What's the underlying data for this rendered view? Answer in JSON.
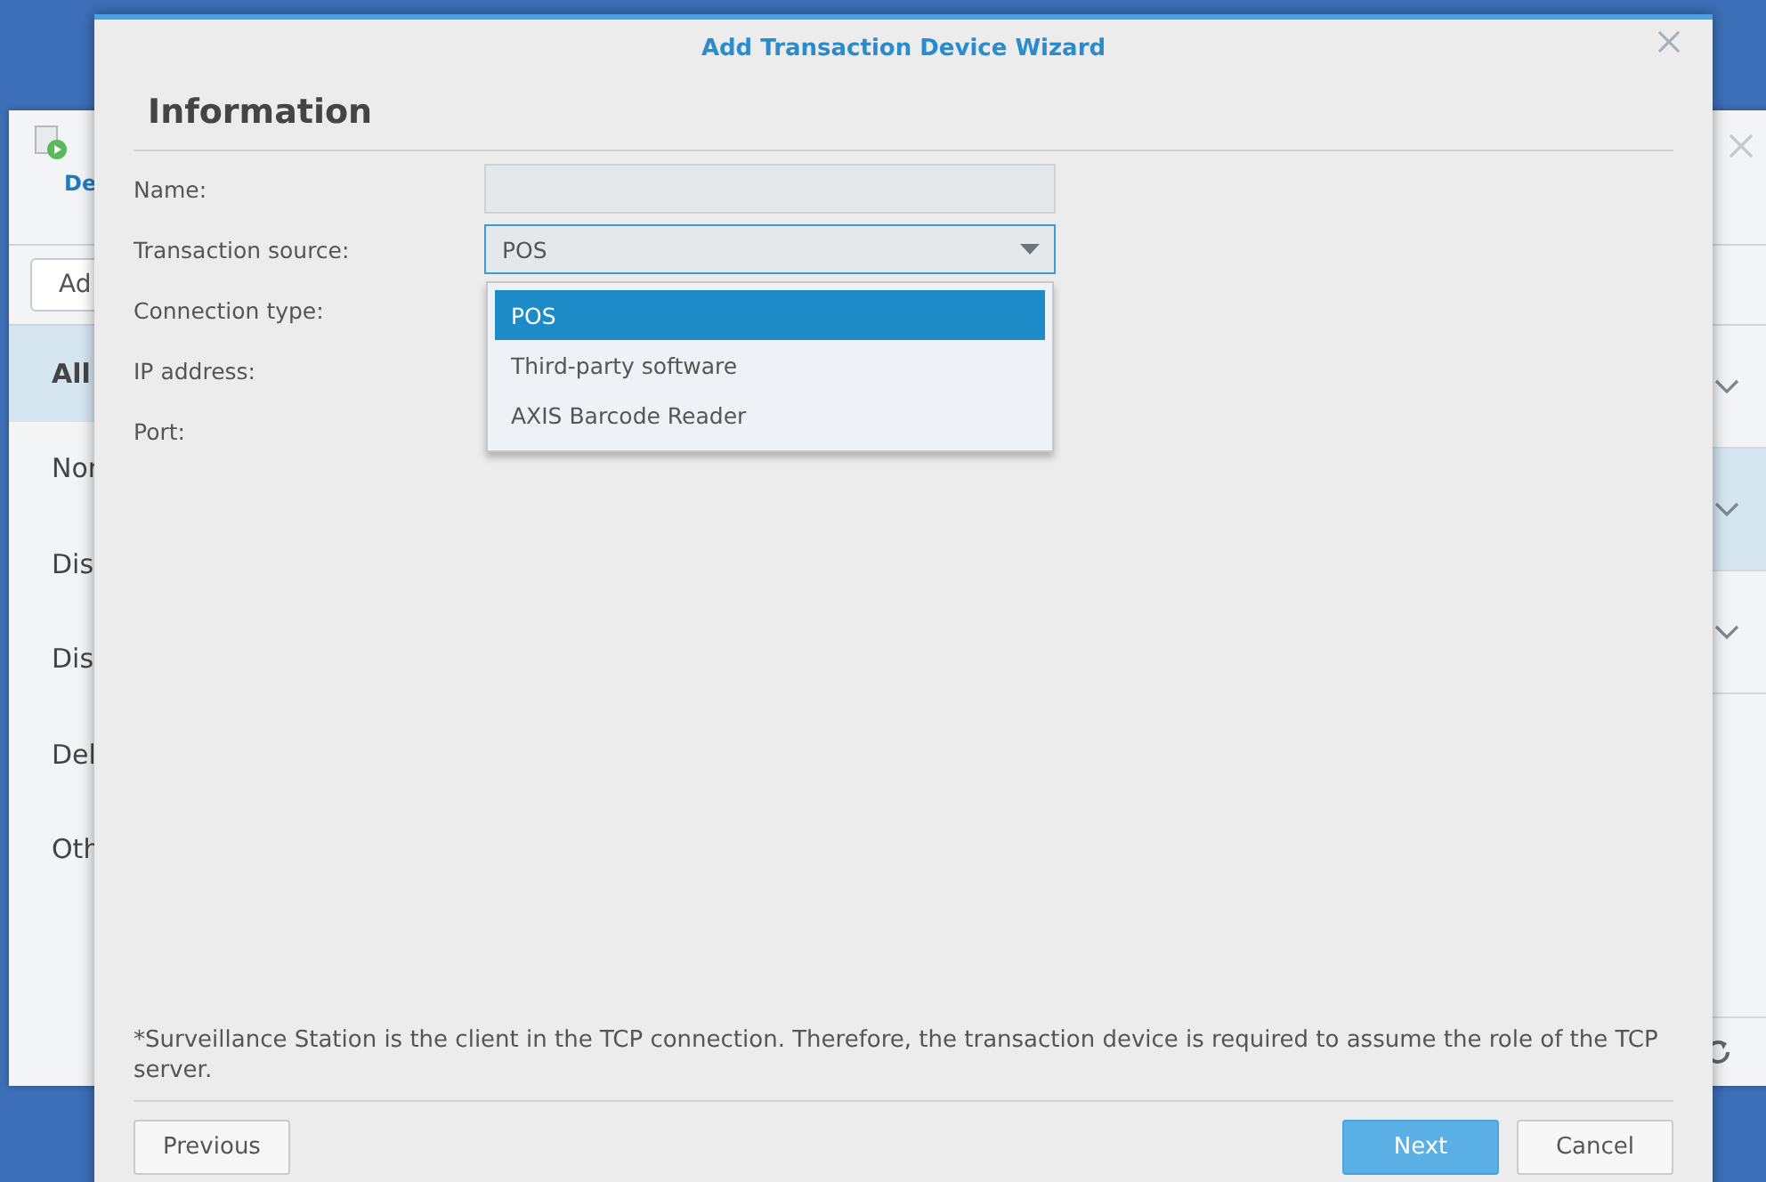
{
  "background_window": {
    "tab": "De",
    "toolbar_button": "Ad",
    "sidebar_items": [
      {
        "label": "All",
        "selected": true
      },
      {
        "label": "Nor",
        "selected": false
      },
      {
        "label": "Dis",
        "selected": false
      },
      {
        "label": "Dis",
        "selected": false
      },
      {
        "label": "Del",
        "selected": false
      },
      {
        "label": "Oth",
        "selected": false
      }
    ],
    "list_rows": [
      {
        "selected": false
      },
      {
        "selected": true
      },
      {
        "selected": false
      }
    ]
  },
  "dialog": {
    "title": "Add Transaction Device Wizard",
    "heading": "Information",
    "fields": [
      {
        "label": "Name:",
        "kind": "text"
      },
      {
        "label": "Transaction source:",
        "kind": "select",
        "value": "POS",
        "expanded": true
      },
      {
        "label": "Connection type:",
        "kind": "hidden"
      },
      {
        "label": "IP address:",
        "kind": "hidden"
      },
      {
        "label": "Port:",
        "kind": "hidden"
      }
    ],
    "dropdown_options": [
      {
        "label": "POS",
        "selected": true
      },
      {
        "label": "Third-party software",
        "selected": false
      },
      {
        "label": "AXIS Barcode Reader",
        "selected": false
      }
    ],
    "note": "*Surveillance Station is the client in the TCP connection. Therefore, the transaction device is required to assume the role of the TCP server.",
    "buttons": [
      {
        "label": "Previous",
        "kind": "secondary"
      },
      {
        "label": "Next",
        "kind": "primary"
      },
      {
        "label": "Cancel",
        "kind": "secondary"
      }
    ]
  }
}
